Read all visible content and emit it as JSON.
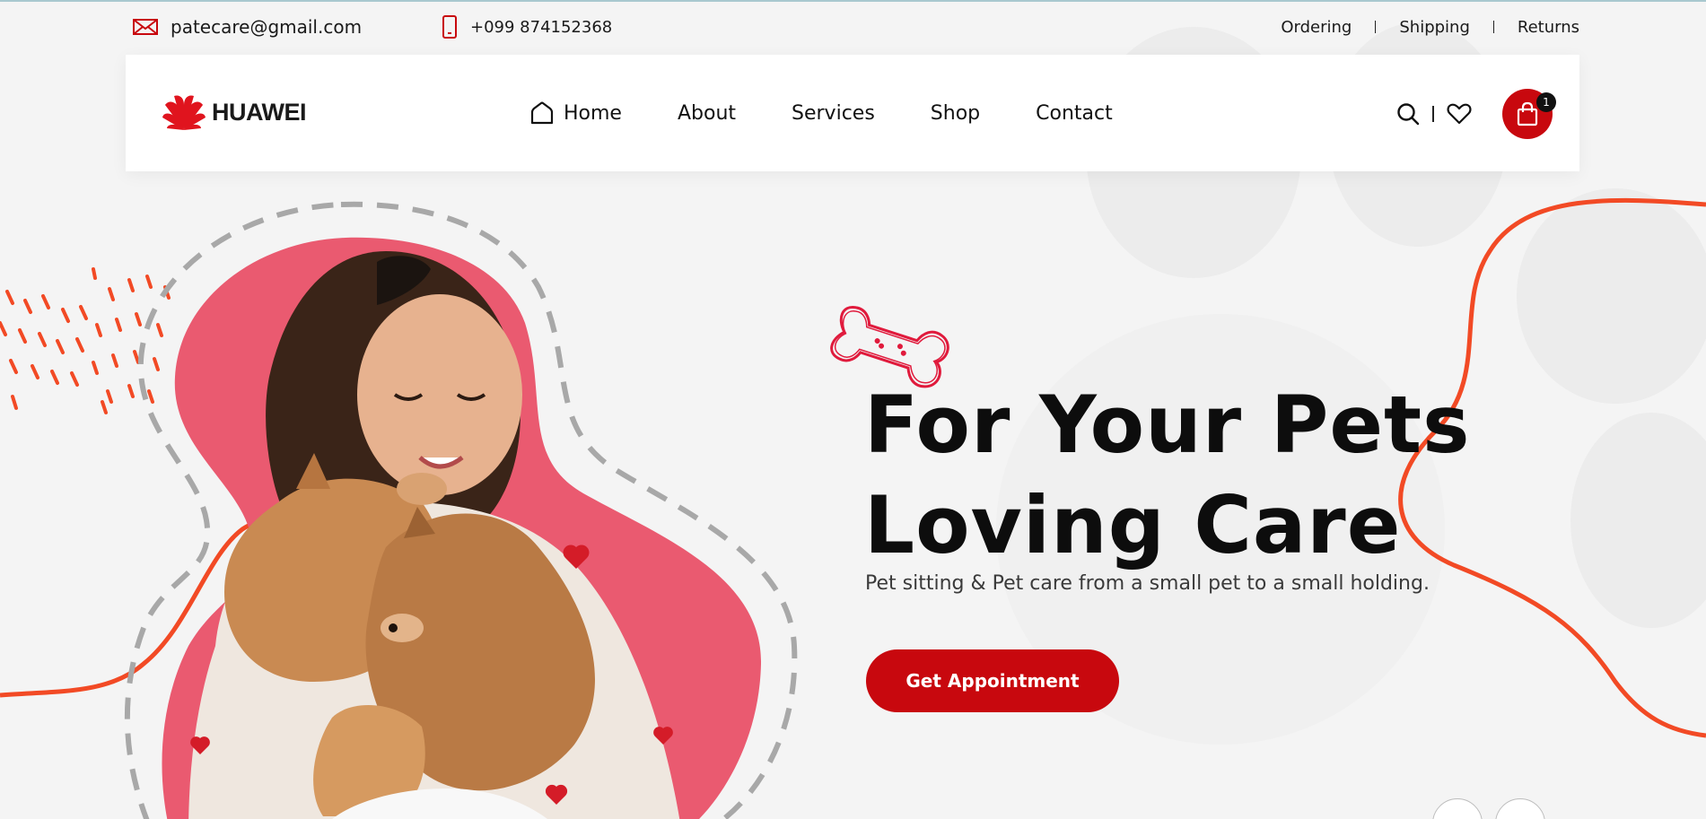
{
  "topbar": {
    "email": "patecare@gmail.com",
    "phone": "+099 874152368",
    "links": [
      "Ordering",
      "Shipping",
      "Returns"
    ]
  },
  "header": {
    "logo_text": "HUAWEI",
    "nav": [
      {
        "label": "Home",
        "icon": "home-icon"
      },
      {
        "label": "About"
      },
      {
        "label": "Services"
      },
      {
        "label": "Shop"
      },
      {
        "label": "Contact"
      }
    ],
    "actions": {
      "search_icon": "search-icon",
      "wishlist_icon": "heart-icon",
      "cart_icon": "shopping-bag-icon",
      "cart_count": "1"
    }
  },
  "hero": {
    "title_line1": "For Your Pets",
    "title_line2": "Loving Care",
    "subtitle": "Pet sitting & Pet care from a small pet to a small holding.",
    "cta_label": "Get Appointment",
    "decor_icon": "bone-icon"
  },
  "colors": {
    "brand_red": "#c8080e",
    "accent_orange": "#f24a25",
    "pink_blob": "#ea5a70",
    "background": "#f4f4f4"
  }
}
